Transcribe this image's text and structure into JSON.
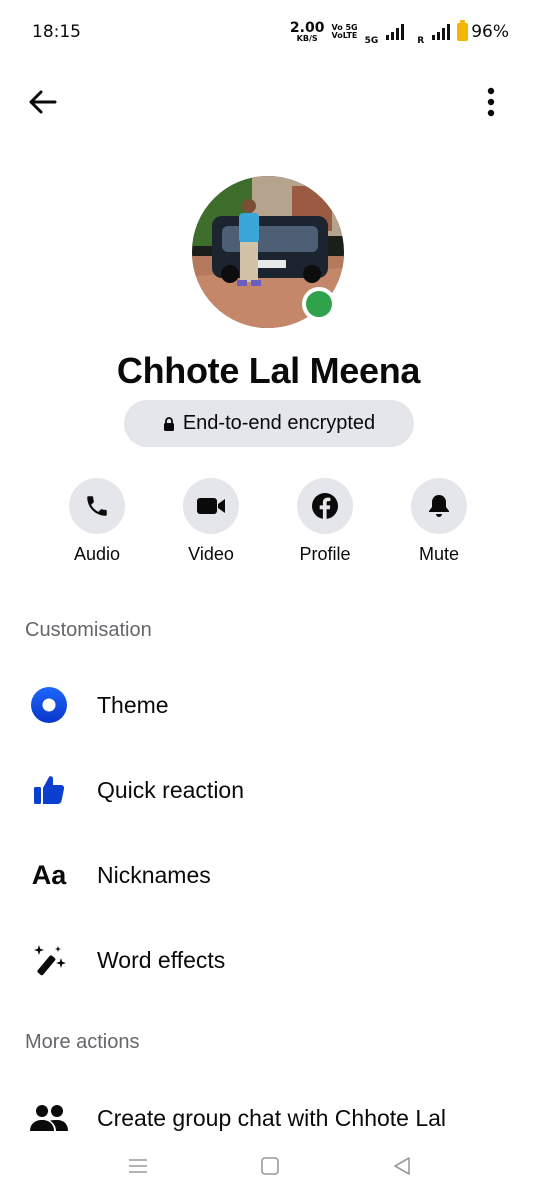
{
  "status_bar": {
    "time": "18:15",
    "net_speed_value": "2.00",
    "net_speed_unit": "KB/S",
    "network_tech_1": "Vo 5G",
    "network_tech_2": "VoLTE",
    "sim1_label": "5G",
    "sim2_label": "R",
    "battery_percent": "96%",
    "battery_color": "#f2b500"
  },
  "top_bar": {
    "back_icon": "arrow-left-icon",
    "more_icon": "more-vertical-icon"
  },
  "profile": {
    "name": "Chhote Lal Meena",
    "online": true,
    "online_color": "#31a24c",
    "encryption_label": "End-to-end encrypted"
  },
  "actions": [
    {
      "label": "Audio",
      "icon": "phone-icon"
    },
    {
      "label": "Video",
      "icon": "video-camera-icon"
    },
    {
      "label": "Profile",
      "icon": "facebook-icon"
    },
    {
      "label": "Mute",
      "icon": "bell-icon"
    }
  ],
  "customisation": {
    "title": "Customisation",
    "items": [
      {
        "label": "Theme",
        "icon": "theme-circle-icon",
        "color": "#0a50e0"
      },
      {
        "label": "Quick reaction",
        "icon": "thumbs-up-icon",
        "color": "#0a3fd0"
      },
      {
        "label": "Nicknames",
        "icon": "Aa",
        "color": "#0a0a0a"
      },
      {
        "label": "Word effects",
        "icon": "magic-wand-icon",
        "color": "#0a0a0a"
      }
    ]
  },
  "more_actions": {
    "title": "More actions",
    "items": [
      {
        "label": "Create group chat with Chhote Lal",
        "icon": "people-icon"
      }
    ]
  },
  "nav_bar": {
    "icons": [
      "menu-icon",
      "home-square-icon",
      "back-triangle-icon"
    ]
  }
}
